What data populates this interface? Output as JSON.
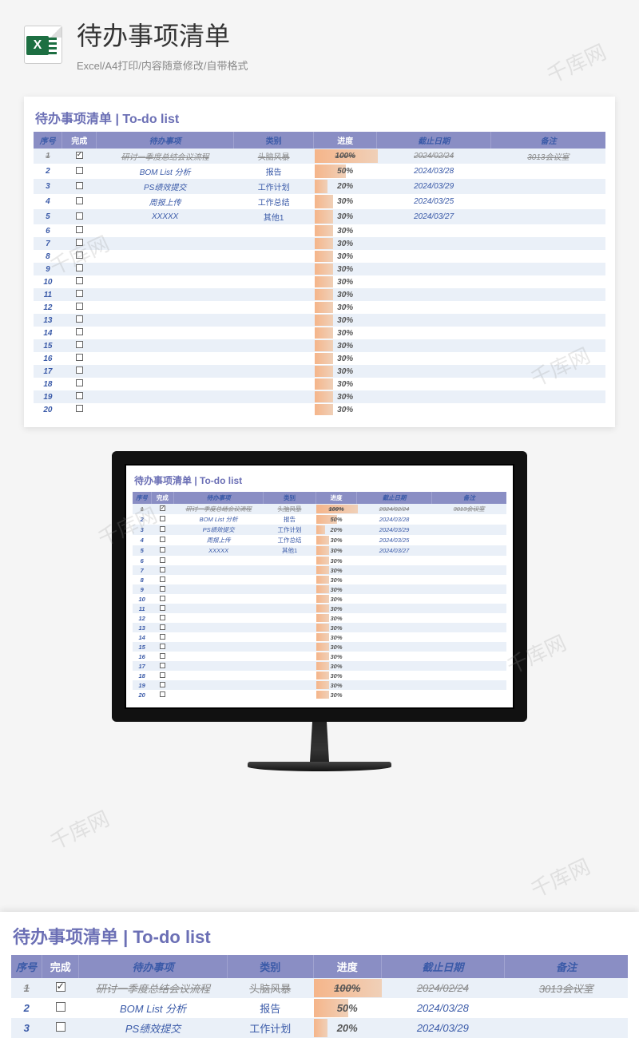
{
  "header": {
    "icon_letter": "X",
    "title": "待办事项清单",
    "subtitle": "Excel/A4打印/内容随意修改/自带格式"
  },
  "sheet": {
    "title": "待办事项清单 | To-do list",
    "columns": {
      "seq": "序号",
      "done": "完成",
      "task": "待办事项",
      "category": "类别",
      "progress": "进度",
      "deadline": "截止日期",
      "note": "备注"
    }
  },
  "chart_data": {
    "type": "table",
    "rows": [
      {
        "seq": 1,
        "done": true,
        "task": "研讨一季度总结会议流程",
        "category": "头脑风暴",
        "progress": 100,
        "deadline": "2024/02/24",
        "note": "3013会议室"
      },
      {
        "seq": 2,
        "done": false,
        "task": "BOM List 分析",
        "category": "报告",
        "progress": 50,
        "deadline": "2024/03/28",
        "note": ""
      },
      {
        "seq": 3,
        "done": false,
        "task": "PS绩效提交",
        "category": "工作计划",
        "progress": 20,
        "deadline": "2024/03/29",
        "note": ""
      },
      {
        "seq": 4,
        "done": false,
        "task": "周报上传",
        "category": "工作总结",
        "progress": 30,
        "deadline": "2024/03/25",
        "note": ""
      },
      {
        "seq": 5,
        "done": false,
        "task": "XXXXX",
        "category": "其他1",
        "progress": 30,
        "deadline": "2024/03/27",
        "note": ""
      },
      {
        "seq": 6,
        "done": false,
        "task": "",
        "category": "",
        "progress": 30,
        "deadline": "",
        "note": ""
      },
      {
        "seq": 7,
        "done": false,
        "task": "",
        "category": "",
        "progress": 30,
        "deadline": "",
        "note": ""
      },
      {
        "seq": 8,
        "done": false,
        "task": "",
        "category": "",
        "progress": 30,
        "deadline": "",
        "note": ""
      },
      {
        "seq": 9,
        "done": false,
        "task": "",
        "category": "",
        "progress": 30,
        "deadline": "",
        "note": ""
      },
      {
        "seq": 10,
        "done": false,
        "task": "",
        "category": "",
        "progress": 30,
        "deadline": "",
        "note": ""
      },
      {
        "seq": 11,
        "done": false,
        "task": "",
        "category": "",
        "progress": 30,
        "deadline": "",
        "note": ""
      },
      {
        "seq": 12,
        "done": false,
        "task": "",
        "category": "",
        "progress": 30,
        "deadline": "",
        "note": ""
      },
      {
        "seq": 13,
        "done": false,
        "task": "",
        "category": "",
        "progress": 30,
        "deadline": "",
        "note": ""
      },
      {
        "seq": 14,
        "done": false,
        "task": "",
        "category": "",
        "progress": 30,
        "deadline": "",
        "note": ""
      },
      {
        "seq": 15,
        "done": false,
        "task": "",
        "category": "",
        "progress": 30,
        "deadline": "",
        "note": ""
      },
      {
        "seq": 16,
        "done": false,
        "task": "",
        "category": "",
        "progress": 30,
        "deadline": "",
        "note": ""
      },
      {
        "seq": 17,
        "done": false,
        "task": "",
        "category": "",
        "progress": 30,
        "deadline": "",
        "note": ""
      },
      {
        "seq": 18,
        "done": false,
        "task": "",
        "category": "",
        "progress": 30,
        "deadline": "",
        "note": ""
      },
      {
        "seq": 19,
        "done": false,
        "task": "",
        "category": "",
        "progress": 30,
        "deadline": "",
        "note": ""
      },
      {
        "seq": 20,
        "done": false,
        "task": "",
        "category": "",
        "progress": 30,
        "deadline": "",
        "note": ""
      }
    ]
  },
  "zoom_rows": 3,
  "watermark_text": "千库网"
}
